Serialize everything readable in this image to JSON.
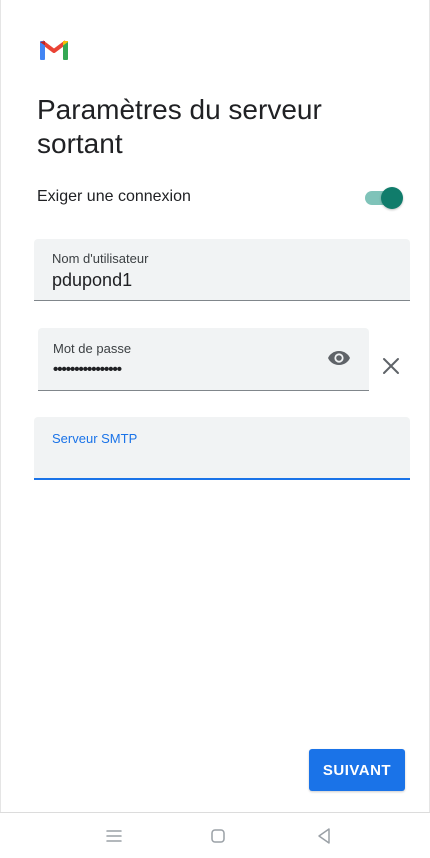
{
  "app": {
    "title": "Paramètres du serveur sortant",
    "logo": "gmail-logo"
  },
  "require_login": {
    "label": "Exiger une connexion",
    "enabled": true
  },
  "username": {
    "label": "Nom d'utilisateur",
    "value": "pdupond1"
  },
  "password": {
    "label": "Mot de passe",
    "masked_value": "••••••••••••••••",
    "toggle_icon": "eye-icon",
    "clear_icon": "close-icon"
  },
  "smtp_server": {
    "label": "Serveur SMTP",
    "value": ""
  },
  "actions": {
    "next_label": "SUIVANT"
  },
  "navigation": {
    "icons": [
      "menu-icon",
      "home-icon",
      "back-icon"
    ]
  },
  "colors": {
    "accent": "#1a73e8",
    "toggle_on": "#107c6b",
    "toggle_track": "#7fc3b9",
    "field_background": "#f1f3f4"
  }
}
